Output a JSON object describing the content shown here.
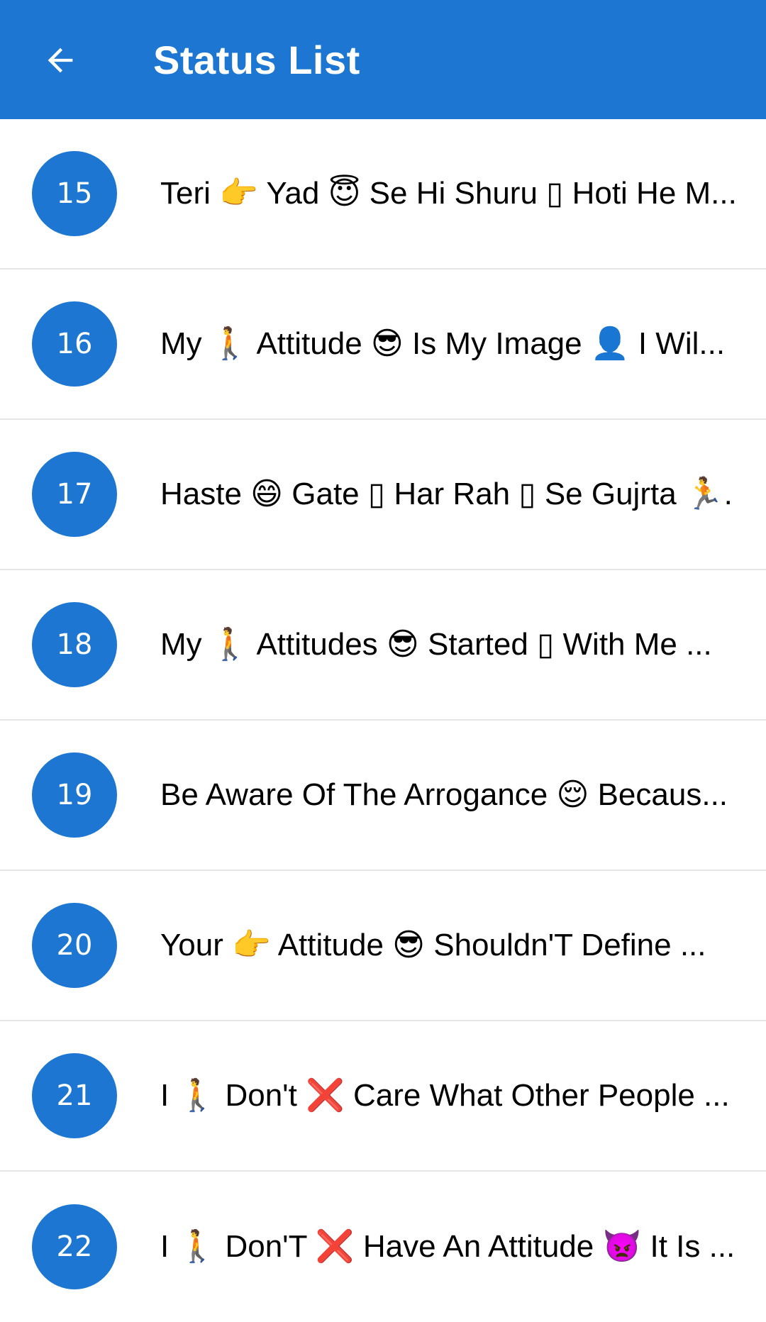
{
  "app_bar": {
    "title": "Status List",
    "back_icon": "arrow-left-icon",
    "background_color": "#1d77d2"
  },
  "list": {
    "badge_color": "#1d77d2",
    "items": [
      {
        "number": "15",
        "text": "Teri 👉 Yad 😇 Se Hi Shuru ▯ Hoti He M..."
      },
      {
        "number": "16",
        "text": "My 🚶 Attitude 😎 Is My Image 👤 I Wil..."
      },
      {
        "number": "17",
        "text": "Haste 😄 Gate ▯ Har Rah ▯ Se Gujrta 🏃..."
      },
      {
        "number": "18",
        "text": "My 🚶 Attitudes 😎 Started ▯ With Me ..."
      },
      {
        "number": "19",
        "text": "Be Aware Of The Arrogance 😌 Becaus..."
      },
      {
        "number": "20",
        "text": "Your 👉 Attitude 😎 Shouldn'T Define ..."
      },
      {
        "number": "21",
        "text": "I 🚶 Don't ❌ Care What Other People ..."
      },
      {
        "number": "22",
        "text": "I 🚶 Don'T ❌ Have An Attitude 👿 It Is ..."
      }
    ]
  }
}
